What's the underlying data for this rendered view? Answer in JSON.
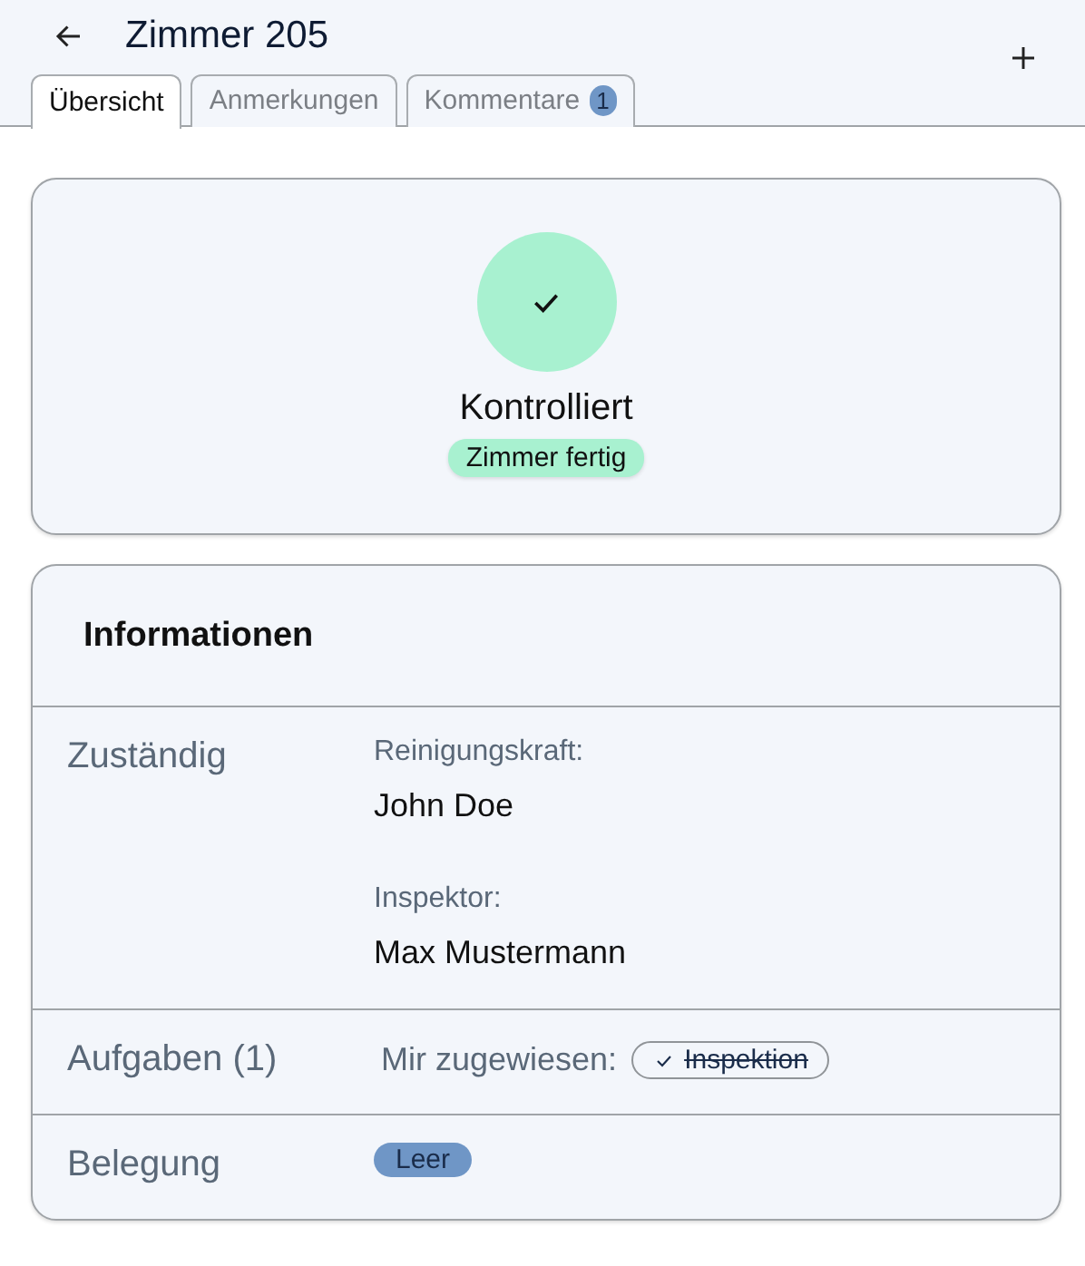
{
  "header": {
    "title": "Zimmer 205"
  },
  "tabs": [
    {
      "label": "Übersicht",
      "selected": true
    },
    {
      "label": "Anmerkungen",
      "selected": false
    },
    {
      "label": "Kommentare",
      "selected": false,
      "badge": "1"
    }
  ],
  "status": {
    "label": "Kontrolliert",
    "tag": "Zimmer fertig"
  },
  "info": {
    "title": "Informationen",
    "rows": [
      {
        "kind": "people",
        "label": "Zuständig",
        "people": [
          {
            "role": "Reinigungskraft:",
            "name": "John Doe"
          },
          {
            "role": "Inspektor:",
            "name": "Max Mustermann"
          }
        ]
      },
      {
        "kind": "tasks",
        "label": "Aufgaben (1)",
        "prefix": "Mir zugewiesen:",
        "tasks": [
          {
            "label": "Inspektion",
            "done": true
          }
        ]
      },
      {
        "kind": "tag",
        "label": "Belegung",
        "tag": "Leer"
      }
    ]
  }
}
